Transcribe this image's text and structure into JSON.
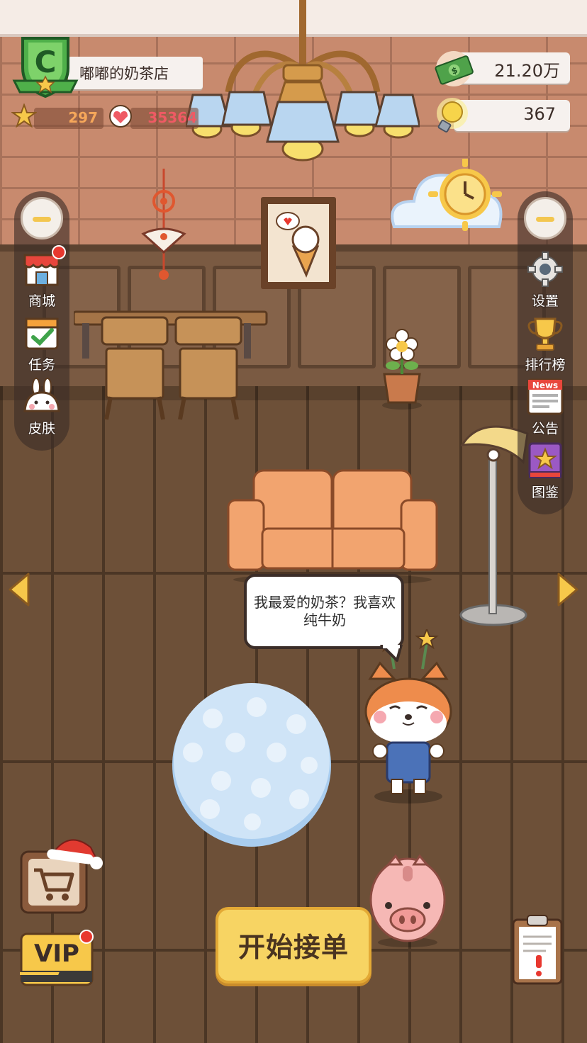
{
  "shop": {
    "name": "嘟嘟的奶茶店",
    "rank": "C",
    "stars": "297",
    "likes": "35364"
  },
  "currency": {
    "money": "21.20万",
    "ideas": "367"
  },
  "left_menu": {
    "items": [
      {
        "label": "商城",
        "icon": "shop-icon",
        "has_badge": true
      },
      {
        "label": "任务",
        "icon": "task-calendar-icon",
        "has_badge": false
      },
      {
        "label": "皮肤",
        "icon": "bunny-skin-icon",
        "has_badge": false
      }
    ]
  },
  "right_menu": {
    "items": [
      {
        "label": "设置",
        "icon": "gear-icon"
      },
      {
        "label": "排行榜",
        "icon": "trophy-icon"
      },
      {
        "label": "公告",
        "icon": "news-icon",
        "badge_text": "News"
      },
      {
        "label": "图鉴",
        "icon": "star-book-icon"
      }
    ]
  },
  "speech_bubble": {
    "text": "我最爱的奶茶？我喜欢纯牛奶"
  },
  "bottom": {
    "start_label": "开始接单",
    "vip_label": "VIP"
  },
  "colors": {
    "accent_yellow": "#f7d463",
    "stars_orange": "#f6a75a",
    "likes_red": "#ef5a64",
    "badge_red": "#e8382f"
  }
}
